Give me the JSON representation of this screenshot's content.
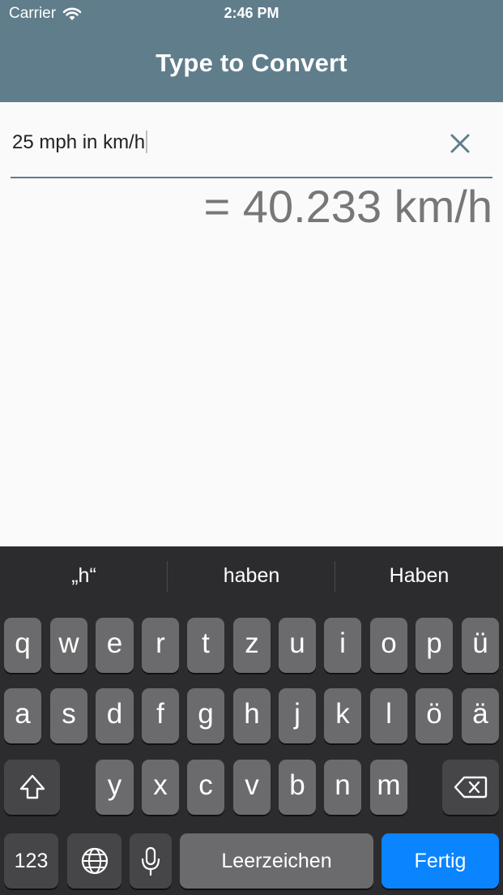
{
  "status_bar": {
    "carrier": "Carrier",
    "time": "2:46 PM"
  },
  "app_bar": {
    "title": "Type to Convert"
  },
  "input": {
    "value": "25 mph in km/h"
  },
  "result": {
    "text": "= 40.233 km/h"
  },
  "keyboard": {
    "suggestions": [
      "„h“",
      "haben",
      "Haben"
    ],
    "row1": [
      "q",
      "w",
      "e",
      "r",
      "t",
      "z",
      "u",
      "i",
      "o",
      "p",
      "ü"
    ],
    "row2": [
      "a",
      "s",
      "d",
      "f",
      "g",
      "h",
      "j",
      "k",
      "l",
      "ö",
      "ä"
    ],
    "row3": [
      "y",
      "x",
      "c",
      "v",
      "b",
      "n",
      "m"
    ],
    "numbers_key": "123",
    "space_key": "Leerzeichen",
    "done_key": "Fertig"
  },
  "colors": {
    "app_bar": "#607d8b",
    "keyboard_bg": "#2c2c2e",
    "done_key": "#0a84ff",
    "result_text": "#777777"
  }
}
